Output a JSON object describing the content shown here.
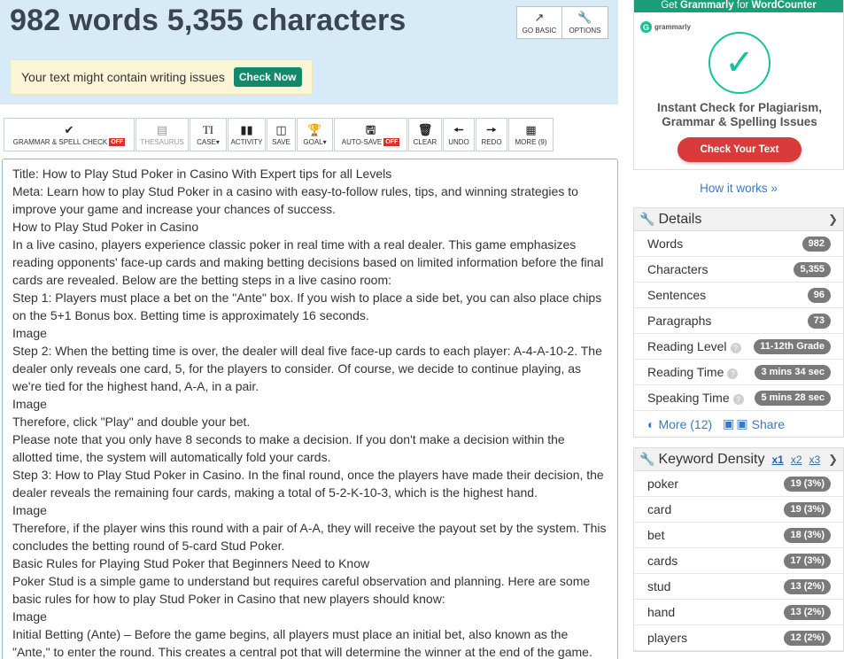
{
  "header": {
    "counts_title": "982 words 5,355 characters",
    "go_basic": "GO BASIC",
    "options": "OPTIONS",
    "issues_text": "Your text might contain writing issues",
    "check_now": "Check Now"
  },
  "toolbar": {
    "items": [
      {
        "label": "GRAMMAR & SPELL CHECK",
        "badge": "OFF",
        "icon": "check-icon"
      },
      {
        "label": "THESAURUS",
        "icon": "book-icon"
      },
      {
        "label": "CASE",
        "icon": "text-case-icon"
      },
      {
        "label": "ACTIVITY",
        "icon": "bar-chart-icon"
      },
      {
        "label": "SAVE",
        "icon": "save-file-icon"
      },
      {
        "label": "GOAL",
        "icon": "trophy-icon"
      },
      {
        "label": "AUTO-SAVE",
        "badge": "OFF",
        "icon": "floppy-icon"
      },
      {
        "label": "CLEAR",
        "icon": "trash-icon"
      },
      {
        "label": "UNDO",
        "icon": "arrow-left-icon"
      },
      {
        "label": "REDO",
        "icon": "arrow-right-icon"
      },
      {
        "label": "MORE (9)",
        "icon": "grid-icon"
      }
    ]
  },
  "editor": {
    "lines": [
      "Title: How to Play Stud Poker in Casino With Expert tips for all Levels",
      "Meta: Learn how to play Stud Poker in a casino with easy-to-follow rules, tips, and winning strategies to improve your game and increase your chances of success.",
      "How to Play Stud Poker in Casino",
      "In a live casino, players experience classic poker in real time with a real dealer. This game emphasizes reading opponents' face-up cards and making betting decisions based on limited information before the final cards are revealed. Below are the betting steps in a live casino room:",
      "Step 1: Players must place a bet on the \"Ante\" box. If you wish to place a side bet, you can also place chips on the 5+1 Bonus box. Betting time is approximately 16 seconds.",
      "Image",
      "Step 2: When the betting time is over, the dealer will deal five face-up cards to each player: A-4-A-10-2. The dealer only reveals one card, 5, for the players to consider. Of course, we decide to continue playing, as we're tied for the highest hand, A-A, in a pair.",
      "Image",
      "Therefore, click \"Play\" and double your bet.",
      "Please note that you only have 8 seconds to make a decision. If you don't make a decision within the allotted time, the system will automatically fold your cards.",
      "Step 3: How to Play Stud Poker in Casino. In the final round, once the players have made their decision, the dealer reveals the remaining four cards, making a total of 5-2-K-10-3, which is the highest hand.",
      "Image",
      "Therefore, if the player wins this round with a pair of A-A, they will receive the payout set by the system. This concludes the betting round of 5-card Stud Poker.",
      "Basic Rules for Playing Stud Poker that Beginners Need to Know",
      "Poker Stud is a simple game to understand but requires careful observation and planning. Here are some basic rules for how to play Stud Poker in Casino that new players should know:",
      "Image",
      "Initial Betting (Ante) – Before the game begins, all players must place an initial bet, also known as the \"Ante,\" to enter the round. This creates a central pot that will determine the winner at the end of the game."
    ]
  },
  "ad": {
    "head_prefix": "Get ",
    "head_brand": "Grammarly",
    "head_mid": " for ",
    "head_target": "WordCounter",
    "logo_text": "grammarly",
    "headline": "Instant Check for Plagiarism, Grammar & Spelling Issues",
    "cta": "Check Your Text",
    "how_it_works": "How it works »"
  },
  "details": {
    "title": "Details",
    "rows": [
      {
        "label": "Words",
        "value": "982"
      },
      {
        "label": "Characters",
        "value": "5,355"
      },
      {
        "label": "Sentences",
        "value": "96"
      },
      {
        "label": "Paragraphs",
        "value": "73"
      },
      {
        "label": "Reading Level",
        "value": "11-12th Grade"
      },
      {
        "label": "Reading Time",
        "value": "3 mins 34 sec"
      },
      {
        "label": "Speaking Time",
        "value": "5 mins 28 sec"
      }
    ],
    "more": "More (12)",
    "share": "Share"
  },
  "keyword_density": {
    "title": "Keyword Density",
    "x1": "x1",
    "x2": "x2",
    "x3": "x3",
    "rows": [
      {
        "word": "poker",
        "value": "19 (3%)"
      },
      {
        "word": "card",
        "value": "19 (3%)"
      },
      {
        "word": "bet",
        "value": "18 (3%)"
      },
      {
        "word": "cards",
        "value": "17 (3%)"
      },
      {
        "word": "stud",
        "value": "13 (2%)"
      },
      {
        "word": "hand",
        "value": "13 (2%)"
      },
      {
        "word": "players",
        "value": "12 (2%)"
      }
    ]
  }
}
